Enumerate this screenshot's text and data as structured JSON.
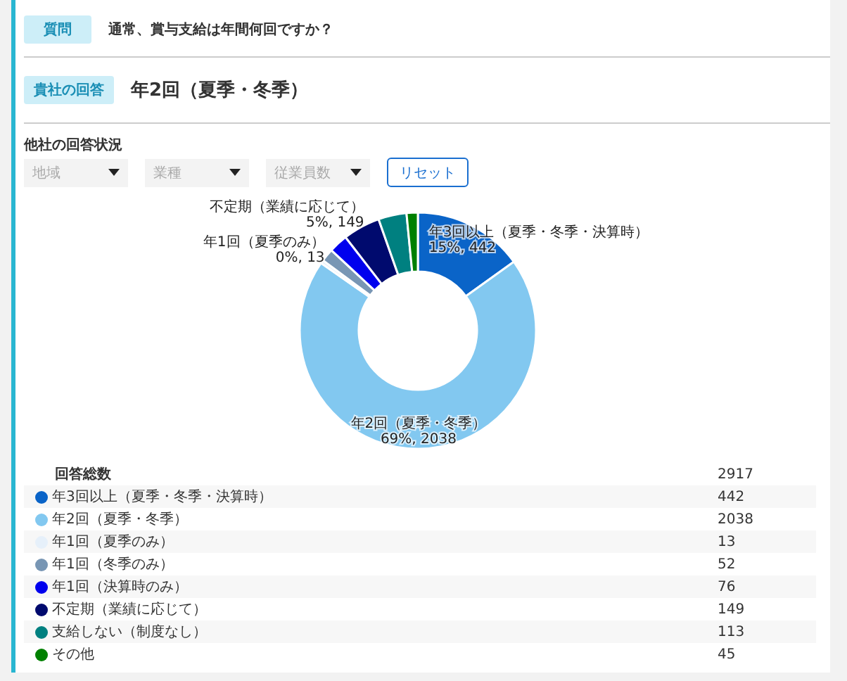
{
  "question": {
    "badge": "質問",
    "text": "通常、賞与支給は年間何回ですか？"
  },
  "answer": {
    "badge": "貴社の回答",
    "text": "年2回（夏季・冬季）"
  },
  "others": {
    "heading": "他社の回答状況",
    "filters": [
      {
        "placeholder": "地域"
      },
      {
        "placeholder": "業種"
      },
      {
        "placeholder": "従業員数"
      }
    ],
    "reset_button": "リセット",
    "chart_data": {
      "type": "donut",
      "categories": [
        "年3回以上（夏季・冬季・決算時）",
        "年2回（夏季・冬季）",
        "年1回（夏季のみ）",
        "年1回（冬季のみ）",
        "年1回（決算時のみ）",
        "不定期（業績に応じて）",
        "支給しない（制度なし）",
        "その他"
      ],
      "colors": [
        "#0a64c8",
        "#82c8f0",
        "#e6f0fa",
        "#7896b4",
        "#0000ee",
        "#000a6e",
        "#008080",
        "#008000"
      ],
      "values": [
        442,
        2038,
        13,
        52,
        76,
        149,
        113,
        45
      ],
      "value_labels": [
        "15%, 442",
        "69%, 2038",
        "0%, 13",
        null,
        null,
        "5%, 149",
        null,
        null
      ]
    },
    "total": {
      "label": "回答総数",
      "value": "2917"
    },
    "legend": [
      {
        "value": "442"
      },
      {
        "value": "2038"
      },
      {
        "value": "13"
      },
      {
        "value": "52"
      },
      {
        "value": "76"
      },
      {
        "value": "149"
      },
      {
        "value": "113"
      },
      {
        "value": "45"
      }
    ]
  }
}
